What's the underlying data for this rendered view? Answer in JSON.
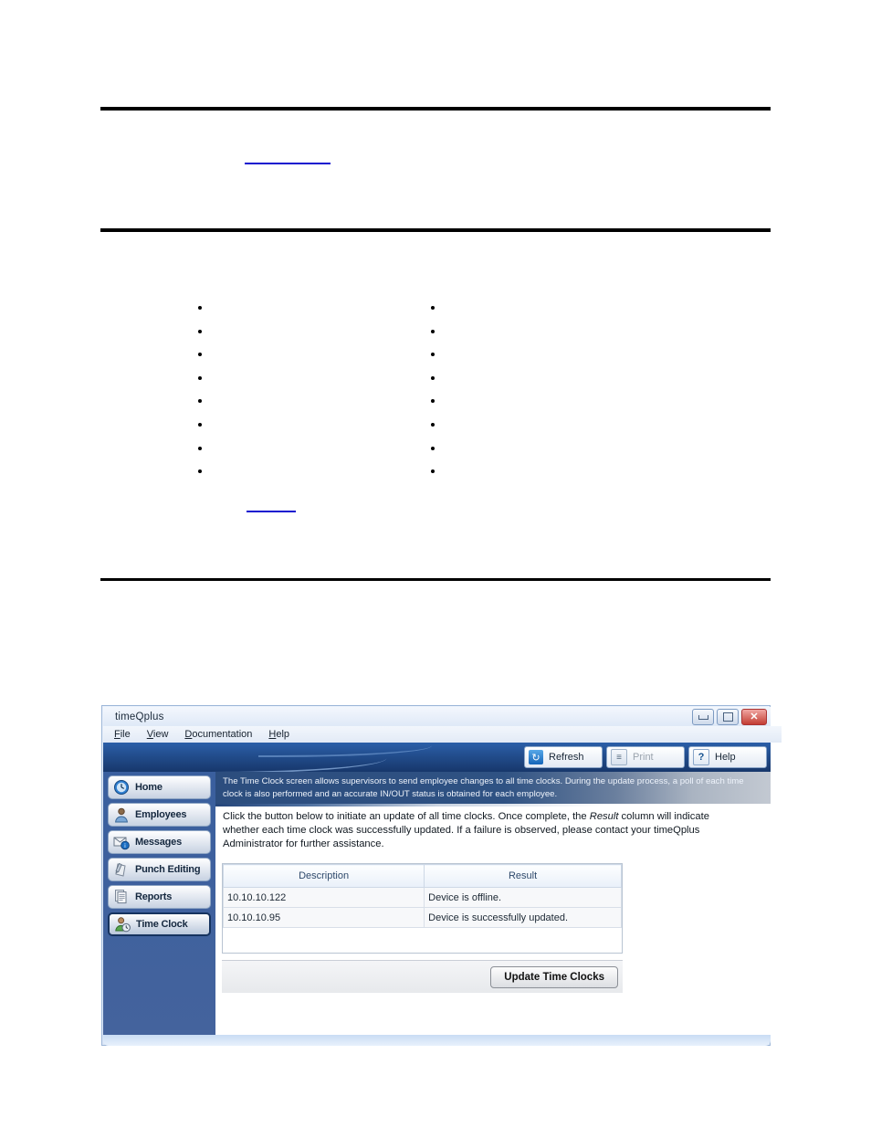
{
  "document": {
    "rules": 3,
    "link_color": "#1414cf",
    "bullet_columns": [
      {
        "count": 8
      },
      {
        "count": 8
      }
    ]
  },
  "window": {
    "title": "timeQplus",
    "controls": {
      "minimize": "minimize-button",
      "maximize": "maximize-button",
      "close_glyph": "✕"
    },
    "menu": [
      {
        "mnemonic": "F",
        "rest": "ile"
      },
      {
        "mnemonic": "V",
        "rest": "iew"
      },
      {
        "mnemonic": "D",
        "rest": "ocumentation"
      },
      {
        "mnemonic": "H",
        "rest": "elp"
      }
    ],
    "toolbar": [
      {
        "label": "Refresh",
        "icon": "refresh-icon",
        "enabled": true
      },
      {
        "label": "Print",
        "icon": "print-icon",
        "enabled": false
      },
      {
        "label": "Help",
        "icon": "help-icon",
        "enabled": true
      }
    ],
    "sidebar": {
      "items": [
        {
          "label": "Home",
          "icon": "clock-icon",
          "selected": false
        },
        {
          "label": "Employees",
          "icon": "person-icon",
          "selected": false
        },
        {
          "label": "Messages",
          "icon": "envelope-info-icon",
          "selected": false
        },
        {
          "label": "Punch Editing",
          "icon": "pen-paper-icon",
          "selected": false
        },
        {
          "label": "Reports",
          "icon": "document-icon",
          "selected": false
        },
        {
          "label": "Time Clock",
          "icon": "person-clock-icon",
          "selected": true
        }
      ]
    },
    "main": {
      "description_banner": "The Time Clock screen allows supervisors to send employee changes to all time clocks. During the update process, a poll of each time clock is also performed and an accurate IN/OUT status is obtained for each employee.",
      "instructions_part1": "Click the button below to initiate an update of all time clocks. Once complete, the ",
      "instructions_italic": "Result",
      "instructions_part2": " column will indicate whether each time clock was successfully updated. If a failure is observed, please contact your timeQplus Administrator for further assistance.",
      "table": {
        "columns": [
          "Description",
          "Result"
        ],
        "rows": [
          [
            "10.10.10.122",
            "Device is offline."
          ],
          [
            "10.10.10.95",
            "Device is successfully updated."
          ]
        ]
      },
      "update_button": "Update Time Clocks"
    }
  },
  "colors": {
    "nav_background": "#3d5f9e",
    "banner_dark": "#2c4d7e",
    "selected_border": "#16335f",
    "close_red": "#c33d33"
  }
}
